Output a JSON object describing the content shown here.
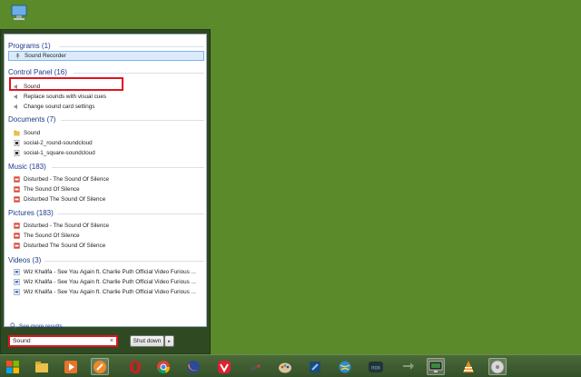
{
  "start_menu": {
    "sections": [
      {
        "header": "Programs (1)",
        "items": [
          {
            "label": "Sound Recorder",
            "icon": "microphone-icon"
          }
        ]
      },
      {
        "header": "Control Panel (16)",
        "items": [
          {
            "label": "Sound",
            "icon": "speaker-icon"
          },
          {
            "label": "Replace sounds with visual cues",
            "icon": "speaker-icon"
          },
          {
            "label": "Change sound card settings",
            "icon": "speaker-icon"
          }
        ]
      },
      {
        "header": "Documents (7)",
        "items": [
          {
            "label": "Sound",
            "icon": "folder-icon"
          },
          {
            "label": "social-2_round-soundcloud",
            "icon": "file-icon"
          },
          {
            "label": "social-1_square-soundcloud",
            "icon": "file-icon"
          }
        ]
      },
      {
        "header": "Music (183)",
        "items": [
          {
            "label": "Disturbed - The Sound Of Silence",
            "icon": "media-file-icon"
          },
          {
            "label": "The Sound Of Silence",
            "icon": "media-file-icon"
          },
          {
            "label": "Disturbed The Sound Of Silence",
            "icon": "media-file-icon"
          }
        ]
      },
      {
        "header": "Pictures (183)",
        "items": [
          {
            "label": "Disturbed - The Sound Of Silence",
            "icon": "media-file-icon"
          },
          {
            "label": "The Sound Of Silence",
            "icon": "media-file-icon"
          },
          {
            "label": "Disturbed The Sound Of Silence",
            "icon": "media-file-icon"
          }
        ]
      },
      {
        "header": "Videos (3)",
        "items": [
          {
            "label": "Wiz Khalifa - See You Again ft. Charlie Puth  Official Video  Furious ...",
            "icon": "video-file-icon"
          },
          {
            "label": "Wiz Khalifa - See You Again ft. Charlie Puth  Official Video  Furious ...",
            "icon": "video-file-icon"
          },
          {
            "label": "Wiz Khalifa - See You Again ft. Charlie Puth  Official Video  Furious ...",
            "icon": "video-file-icon"
          }
        ]
      }
    ],
    "see_more": "See more results",
    "search": {
      "value": "Sound",
      "clear": "×"
    },
    "shutdown_label": "Shut down",
    "shutdown_arrow": "▸"
  },
  "taskbar": {
    "icons": [
      "start-orb-icon",
      "file-explorer-icon",
      "media-player-icon",
      "music-app-icon",
      "opera-icon",
      "chrome-icon",
      "firefox-icon",
      "vivaldi-icon",
      "tool-icon",
      "paint-icon",
      "ide-icon",
      "globe-icon",
      "nox-icon",
      "arrows-icon",
      "monitor-icon",
      "vlc-icon",
      "disk-icon"
    ],
    "nox_label": "nox"
  },
  "colors": {
    "desktop": "#5a8a2a",
    "section_header": "#1e3a8c",
    "highlight_outline": "#e0141e",
    "selected_bg": "#dcebfb"
  }
}
